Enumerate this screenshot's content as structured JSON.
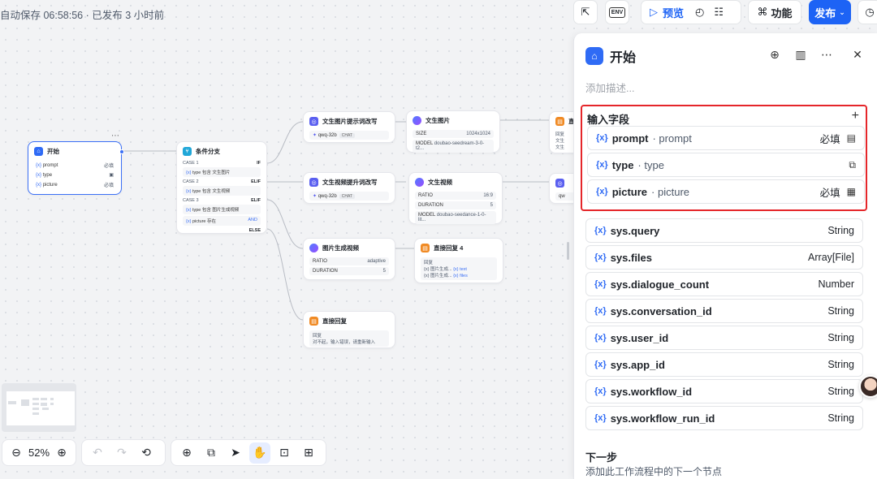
{
  "autosave": "自动保存 06:58:56 · 已发布 3 小时前",
  "toolbar": {
    "env_label": "ENV",
    "preview_label": "预览",
    "feature_label": "功能",
    "publish_label": "发布"
  },
  "canvas": {
    "start_node": {
      "title": "开始",
      "fields": [
        {
          "name": "prompt",
          "badge": "必填"
        },
        {
          "name": "type",
          "badge": ""
        },
        {
          "name": "picture",
          "badge": "必填"
        }
      ]
    },
    "branch_node": {
      "title": "条件分支",
      "cases": [
        {
          "label": "CASE 1",
          "kw": "IF",
          "cond": "type 包含 文生图片"
        },
        {
          "label": "CASE 2",
          "kw": "ELIF",
          "cond": "type 包含 文生视频"
        },
        {
          "label": "CASE 3",
          "kw": "ELIF",
          "cond": "type 包含 图片生成视频"
        }
      ],
      "case3_extra": "picture 存在",
      "and_label": "AND",
      "else_label": "ELSE"
    },
    "rewrite1": {
      "title": "文生图片提示词改写",
      "model": "qwq-32b",
      "tag": "CHAT"
    },
    "rewrite2": {
      "title": "文生视频提升词改写",
      "model": "qwq-32b",
      "tag": "CHAT"
    },
    "t2i": {
      "title": "文生图片",
      "rows": [
        {
          "k": "SIZE",
          "v": "1024x1024"
        },
        {
          "k": "MODEL",
          "v": "doubao-seedream-3-0-t2..."
        }
      ]
    },
    "t2v": {
      "title": "文生视频",
      "rows": [
        {
          "k": "RATIO",
          "v": "16:9"
        },
        {
          "k": "DURATION",
          "v": "5"
        },
        {
          "k": "MODEL",
          "v": "doubao-seedance-1-0-lit..."
        }
      ]
    },
    "i2v": {
      "title": "图片生成视频",
      "rows": [
        {
          "k": "RATIO",
          "v": "adaptive"
        },
        {
          "k": "DURATION",
          "v": "5"
        }
      ]
    },
    "reply4": {
      "title": "直接回复 4",
      "label": "回复",
      "items": [
        "图片生成...",
        "图片生成..."
      ],
      "vars": [
        "text",
        "files"
      ]
    },
    "reply_direct": {
      "title": "直接回复",
      "label": "回复",
      "text": "对不起，输入错误，请重新输入"
    },
    "right_partial1": {
      "title": "直",
      "label": "回复",
      "l1": "文生",
      "l2": "文生"
    },
    "right_partial2": {
      "model": "qw"
    }
  },
  "bottom": {
    "zoom": "52%"
  },
  "panel": {
    "title": "开始",
    "description_placeholder": "添加描述...",
    "input_section_title": "输入字段",
    "input_fields": [
      {
        "name": "prompt",
        "type": "prompt",
        "required": "必填",
        "icon": "text-icon"
      },
      {
        "name": "type",
        "type": "type",
        "required": "",
        "icon": "select-icon"
      },
      {
        "name": "picture",
        "type": "picture",
        "required": "必填",
        "icon": "file-icon"
      }
    ],
    "sys_fields": [
      {
        "name": "sys.query",
        "type": "String"
      },
      {
        "name": "sys.files",
        "type": "Array[File]"
      },
      {
        "name": "sys.dialogue_count",
        "type": "Number"
      },
      {
        "name": "sys.conversation_id",
        "type": "String"
      },
      {
        "name": "sys.user_id",
        "type": "String"
      },
      {
        "name": "sys.app_id",
        "type": "String"
      },
      {
        "name": "sys.workflow_id",
        "type": "String"
      },
      {
        "name": "sys.workflow_run_id",
        "type": "String"
      }
    ],
    "next_title": "下一步",
    "next_desc": "添加此工作流程中的下一个节点"
  },
  "var_prefix": "{x}"
}
